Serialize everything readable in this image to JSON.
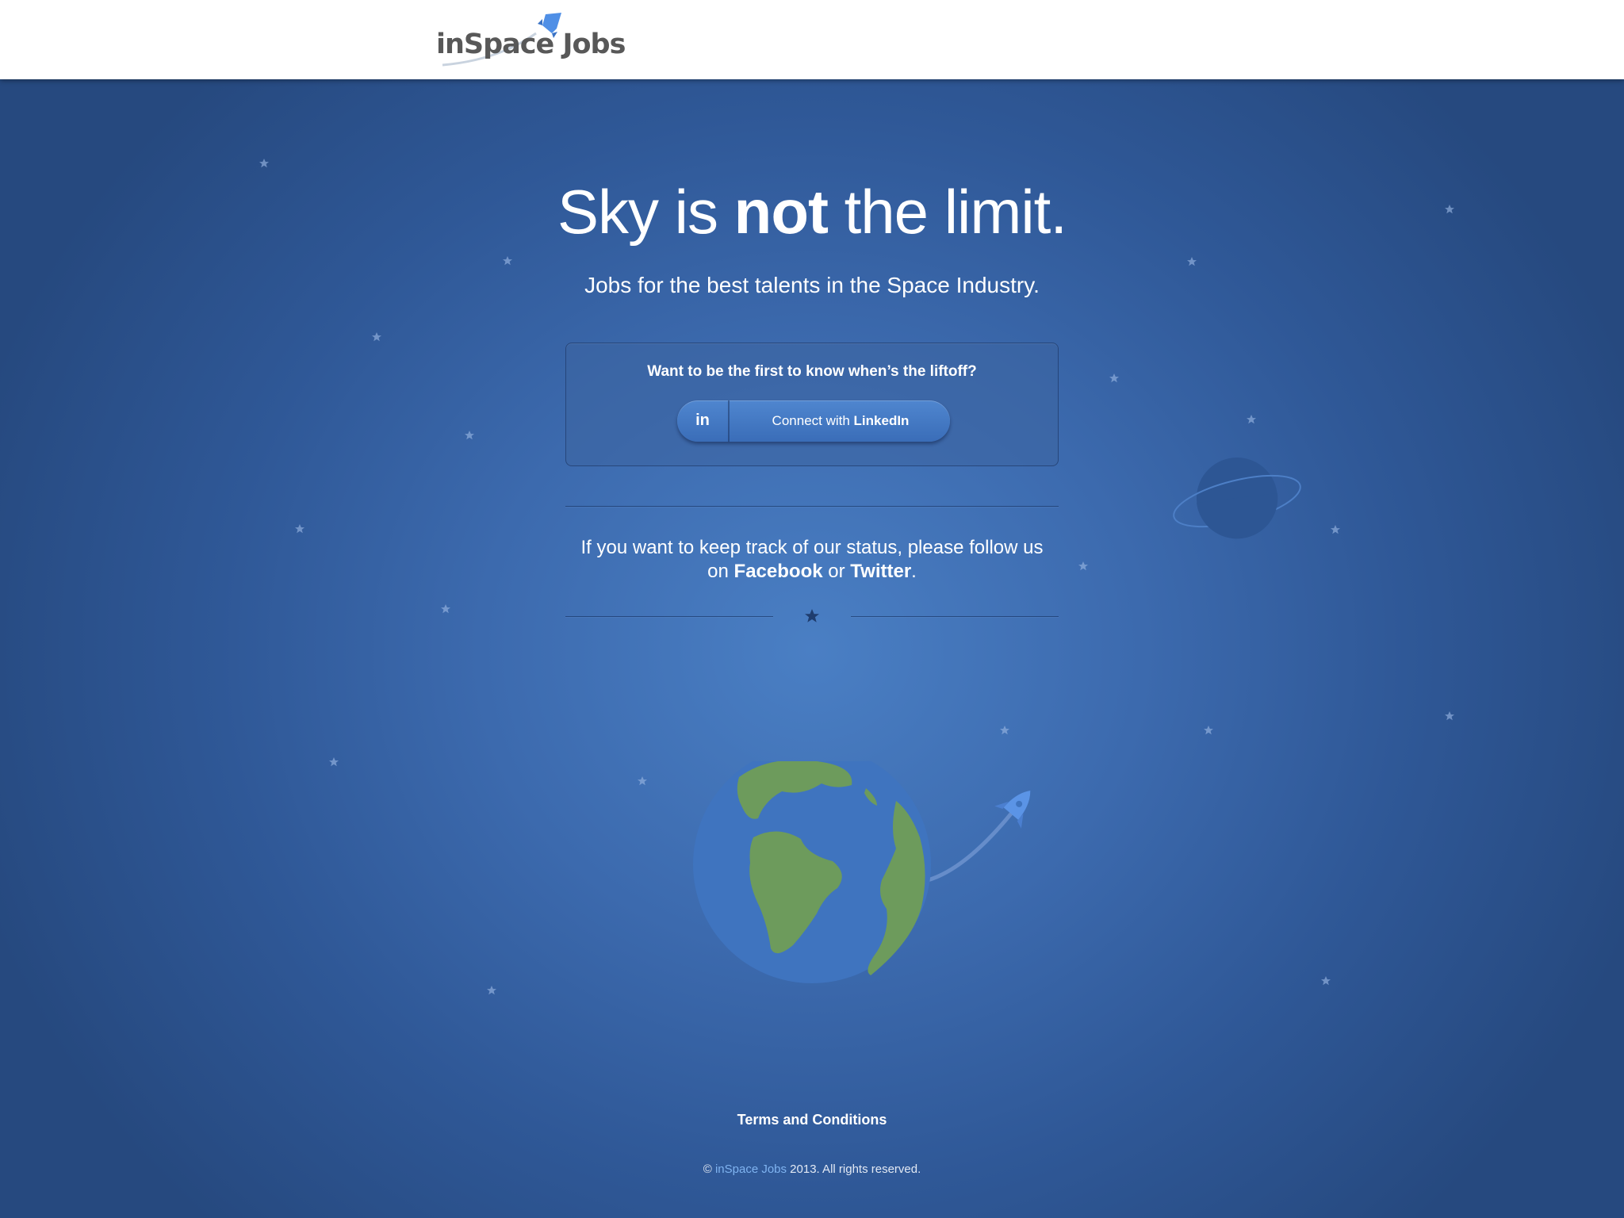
{
  "header": {
    "logo_text": "inSpace Jobs"
  },
  "hero": {
    "title_part1": "Sky is ",
    "title_bold": "not",
    "title_part2": " the limit.",
    "subtitle": "Jobs for the best talents in the Space Industry."
  },
  "cta": {
    "question": "Want to be the first to know when’s the liftoff?",
    "linkedin_icon_text": "in",
    "button_prefix": "Connect with ",
    "button_bold": "LinkedIn"
  },
  "follow": {
    "line1": "If you want to keep track of our status, please follow us",
    "prefix": "on ",
    "facebook": "Facebook",
    "middle": " or ",
    "twitter": "Twitter",
    "suffix": "."
  },
  "footer": {
    "terms": "Terms and Conditions",
    "copyright_symbol": "©",
    "copyright_brand": "inSpace Jobs",
    "copyright_rest": " 2013. All rights reserved."
  },
  "colors": {
    "background": "#3c6aae",
    "earth_ocean": "#3f74bf",
    "earth_land": "#6d9b5c",
    "rocket": "#5b94e6",
    "accent_link": "#7fb3f0"
  },
  "icons": [
    "rocket-icon",
    "linkedin-icon",
    "star-icon",
    "planet-icon",
    "earth-icon"
  ]
}
